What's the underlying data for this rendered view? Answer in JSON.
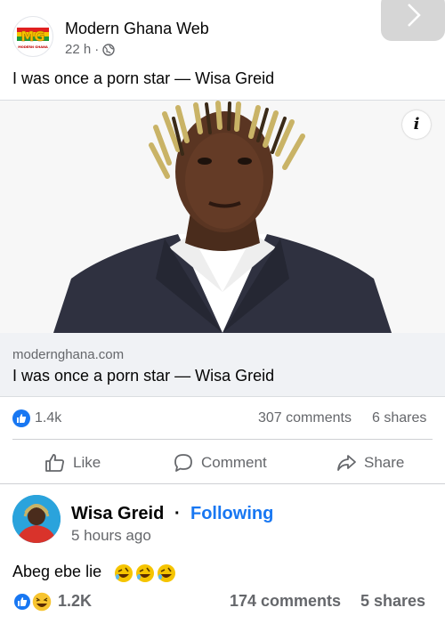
{
  "nav": {
    "next_icon": "chevron-right-icon"
  },
  "post": {
    "page_name": "Modern Ghana Web",
    "time": "22 h",
    "separator": "·",
    "audience_icon": "globe-icon",
    "logo_text": "MG",
    "logo_subtext": "MODERN GHANA",
    "caption": "I was once a porn star — Wisa Greid",
    "link": {
      "domain": "modernghana.com",
      "title": "I was once a porn star — Wisa Greid",
      "info_label": "i"
    },
    "stats": {
      "reactions": "1.4k",
      "comments": "307 comments",
      "shares": "6 shares"
    },
    "actions": {
      "like": "Like",
      "comment": "Comment",
      "share": "Share"
    }
  },
  "comment_post": {
    "name": "Wisa Greid",
    "separator": "·",
    "follow_status": "Following",
    "time": "5 hours ago",
    "text": "Abeg ebe lie",
    "emojis": [
      "rolling-laughing-emoji",
      "rolling-laughing-emoji",
      "rolling-laughing-emoji"
    ],
    "stats": {
      "reactions": "1.2K",
      "comments": "174 comments",
      "shares": "5 shares"
    }
  },
  "colors": {
    "facebook_blue": "#1877f2",
    "secondary_text": "#65676b",
    "link_area_bg": "#f0f2f5"
  }
}
